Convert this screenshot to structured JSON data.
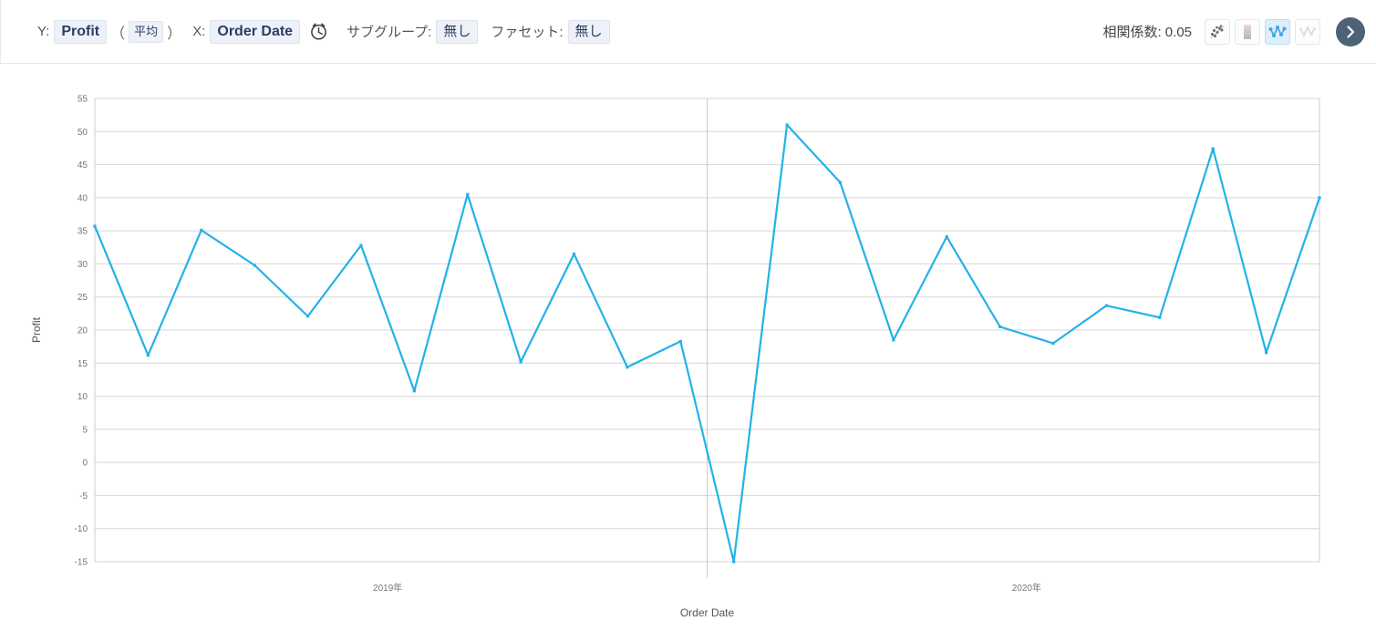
{
  "toolbar": {
    "y_label": "Y:",
    "y_field": "Profit",
    "paren_open": "（",
    "aggregate": "平均",
    "paren_close": "）",
    "x_label": "X:",
    "x_field": "Order Date",
    "time_icon": "clock-icon",
    "subgroup_label": "サブグループ:",
    "subgroup_value": "無し",
    "facet_label": "ファセット:",
    "facet_value": "無し",
    "correlation_text": "相関係数: 0.05",
    "chart_types": [
      {
        "name": "scatter-plot-icon",
        "active": false
      },
      {
        "name": "heatmap-icon",
        "active": false
      },
      {
        "name": "line-with-points-icon",
        "active": true
      },
      {
        "name": "line-chart-icon",
        "active": false
      }
    ],
    "next_label": "›"
  },
  "chart_data": {
    "type": "line",
    "title": "",
    "subtitle": "",
    "xlabel": "Order Date",
    "ylabel": "Profit",
    "ylim": [
      -15,
      55
    ],
    "ytick_step": 5,
    "yticks": [
      55,
      50,
      45,
      40,
      35,
      30,
      25,
      20,
      15,
      10,
      5,
      0,
      -5,
      -10,
      -15
    ],
    "xtick_labels": [
      "2019年",
      "2020年"
    ],
    "xtick_positions": [
      5.5,
      17.5
    ],
    "x_separator_index": 11.5,
    "grid": true,
    "legend": false,
    "line_color": "#22b2e8",
    "point_color": "#22b2e8",
    "categories": [
      "2019-01",
      "2019-02",
      "2019-03",
      "2019-04",
      "2019-05",
      "2019-06",
      "2019-07",
      "2019-08",
      "2019-09",
      "2019-10",
      "2019-11",
      "2019-12",
      "2020-01",
      "2020-02",
      "2020-03",
      "2020-04",
      "2020-05",
      "2020-06",
      "2020-07",
      "2020-08",
      "2020-09",
      "2020-10",
      "2020-11",
      "2020-12"
    ],
    "values": [
      35.7,
      16.2,
      35.1,
      29.8,
      22.1,
      32.8,
      10.8,
      40.5,
      15.2,
      31.5,
      14.4,
      18.3,
      -15.0,
      51.0,
      42.3,
      18.5,
      34.1,
      20.5,
      18.0,
      23.7,
      21.9,
      47.4,
      16.6,
      40.0
    ],
    "series": [
      {
        "name": "Profit (平均)",
        "values": [
          35.7,
          16.2,
          35.1,
          29.8,
          22.1,
          32.8,
          10.8,
          40.5,
          15.2,
          31.5,
          14.4,
          18.3,
          -15.0,
          51.0,
          42.3,
          18.5,
          34.1,
          20.5,
          18.0,
          23.7,
          21.9,
          47.4,
          16.6,
          40.0
        ]
      }
    ]
  },
  "colors": {
    "accent": "#22b2e8",
    "pill_bg": "#eef2f8",
    "pill_text": "#2c3e63",
    "toggle_active_bg": "#ddeefc",
    "next_button_bg": "#4d6375",
    "grid": "#d6d6d6"
  }
}
